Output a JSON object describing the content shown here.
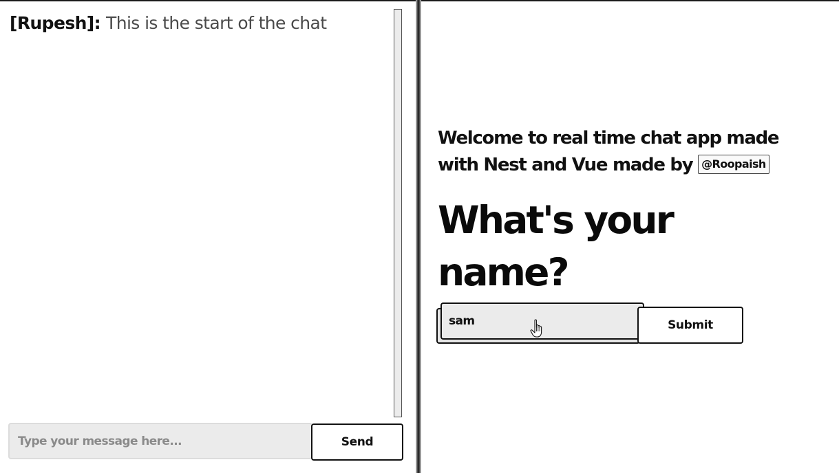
{
  "left_pane": {
    "messages": [
      {
        "user": "[Rupesh]:",
        "text": "This is the start of the chat"
      }
    ],
    "message_input": {
      "placeholder": "Type your message here...",
      "value": ""
    },
    "send_label": "Send"
  },
  "right_pane": {
    "welcome_text": "Welcome to real time chat app made with Nest and Vue made by",
    "author": "@Roopaish",
    "heading": "What's your name?",
    "name_input": {
      "value": "sam",
      "placeholder": ""
    },
    "submit_label": "Submit"
  },
  "icons": {
    "cursor": "hand-pointer-icon"
  }
}
